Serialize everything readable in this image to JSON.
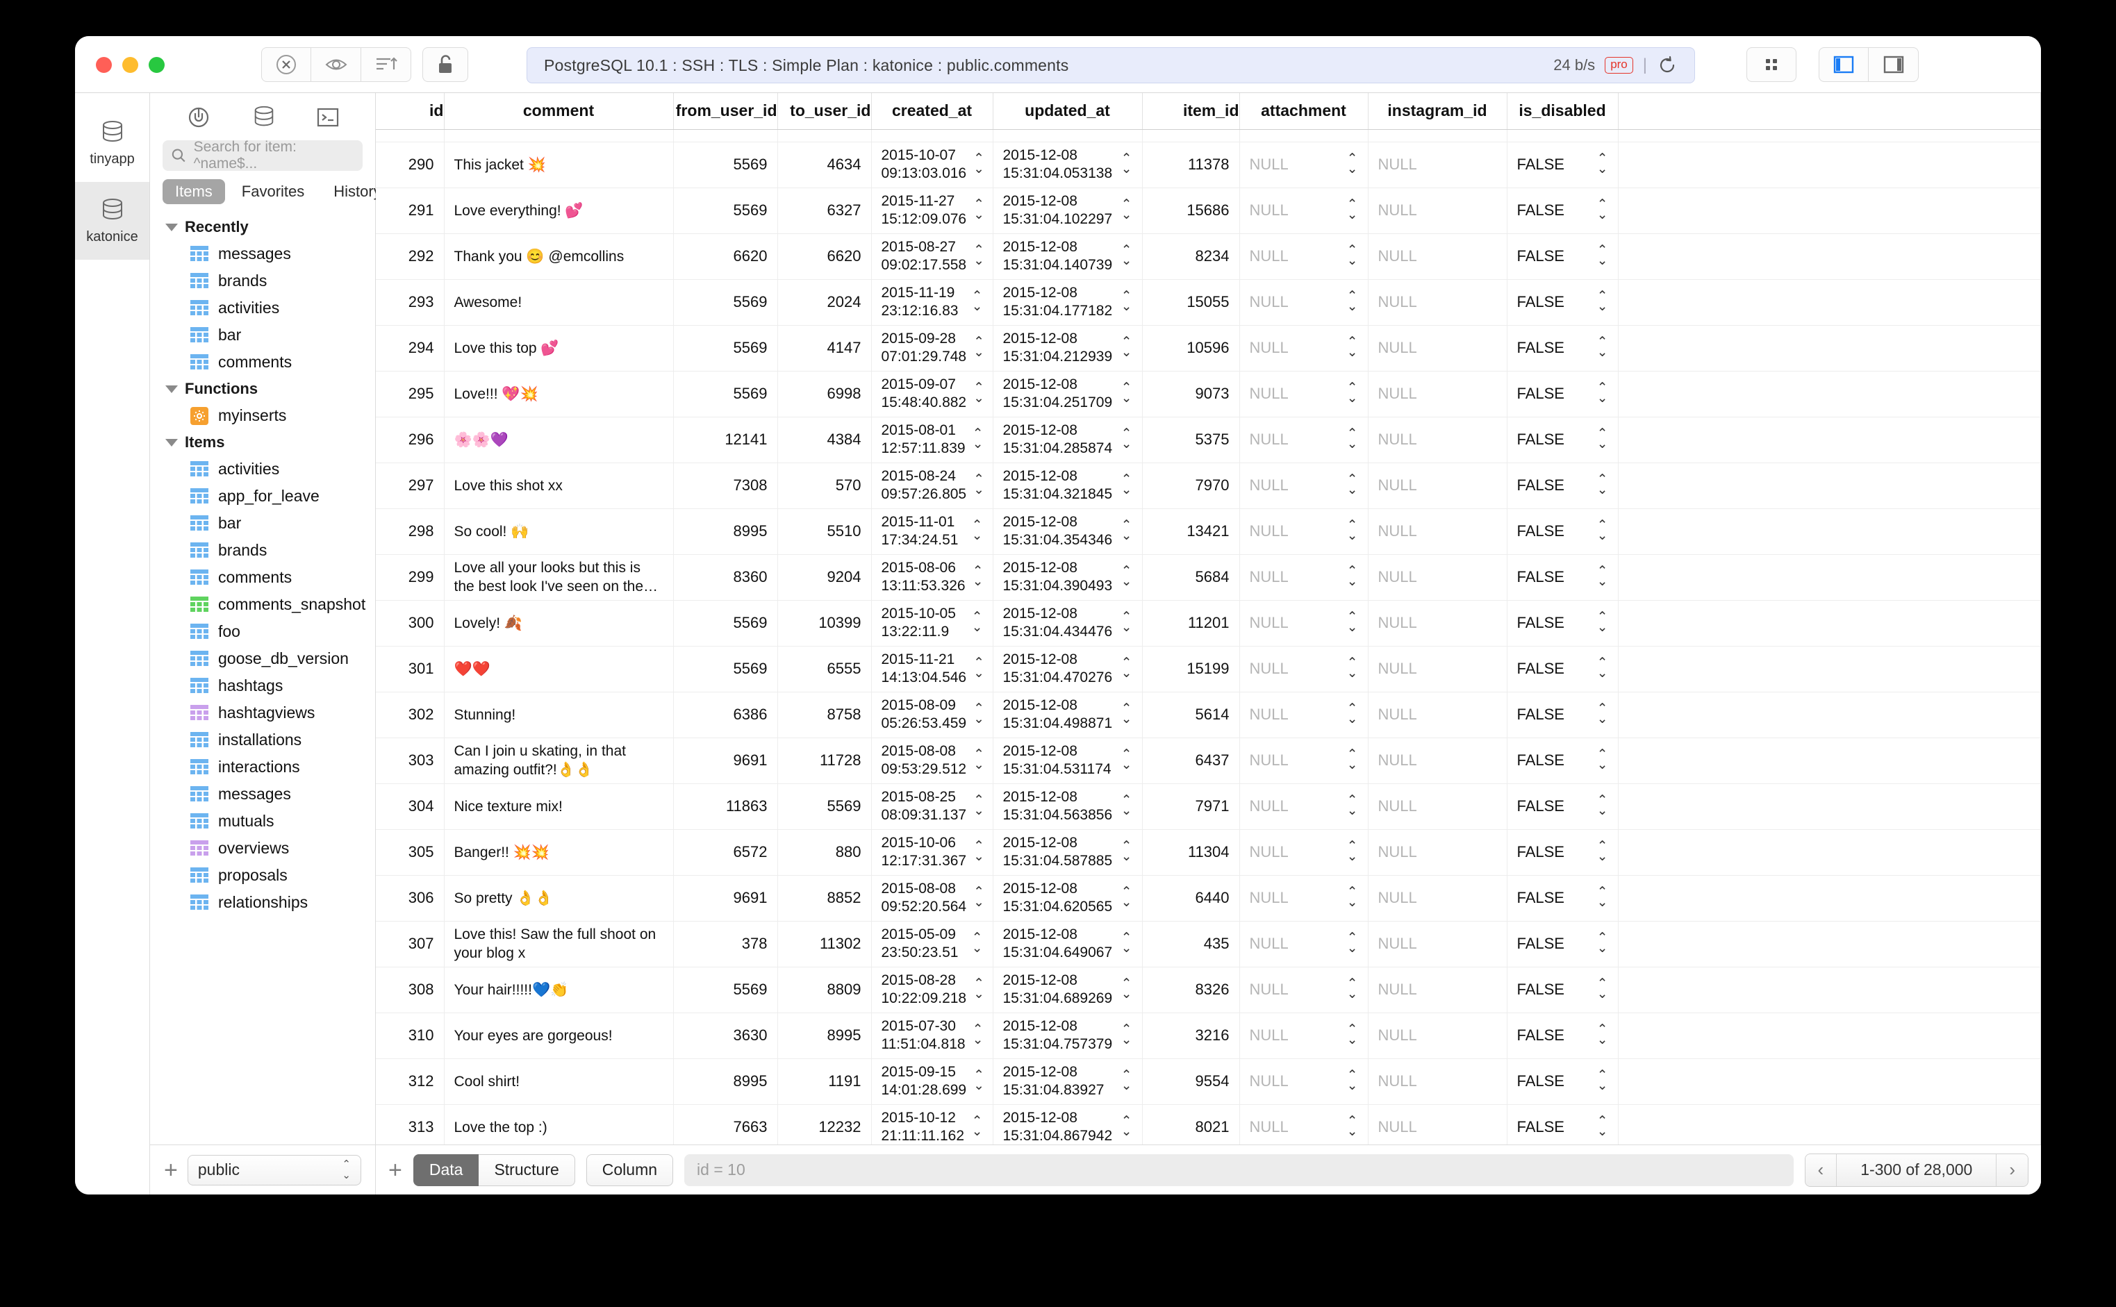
{
  "window": {
    "title": "PostgreSQL 10.1 : SSH : TLS : Simple Plan : katonice : public.comments",
    "throughput": "24 b/s",
    "pro_badge": "pro",
    "separator": "|"
  },
  "rail": {
    "items": [
      {
        "label": "tinyapp",
        "icon": "database-icon",
        "selected": false
      },
      {
        "label": "katonice",
        "icon": "database-icon",
        "selected": true
      }
    ]
  },
  "sidebar": {
    "icons": [
      "plugin-icon",
      "database-icon",
      "terminal-icon"
    ],
    "search": {
      "placeholder": "Search for item: ^name$..."
    },
    "tabs": [
      {
        "label": "Items",
        "selected": true
      },
      {
        "label": "Favorites",
        "selected": false
      },
      {
        "label": "History",
        "selected": false
      }
    ],
    "groups": [
      {
        "label": "Recently",
        "nodes": [
          {
            "label": "messages",
            "kind": "table",
            "color": "#6cb4f0"
          },
          {
            "label": "brands",
            "kind": "table",
            "color": "#6cb4f0"
          },
          {
            "label": "activities",
            "kind": "table",
            "color": "#6cb4f0"
          },
          {
            "label": "bar",
            "kind": "table",
            "color": "#6cb4f0"
          },
          {
            "label": "comments",
            "kind": "table",
            "color": "#6cb4f0"
          }
        ]
      },
      {
        "label": "Functions",
        "nodes": [
          {
            "label": "myinserts",
            "kind": "function",
            "color": "#f6a02f"
          }
        ]
      },
      {
        "label": "Items",
        "nodes": [
          {
            "label": "activities",
            "kind": "table",
            "color": "#6cb4f0"
          },
          {
            "label": "app_for_leave",
            "kind": "table",
            "color": "#6cb4f0"
          },
          {
            "label": "bar",
            "kind": "table",
            "color": "#6cb4f0"
          },
          {
            "label": "brands",
            "kind": "table",
            "color": "#6cb4f0"
          },
          {
            "label": "comments",
            "kind": "table",
            "color": "#6cb4f0"
          },
          {
            "label": "comments_snapshot",
            "kind": "table",
            "color": "#5fd35f"
          },
          {
            "label": "foo",
            "kind": "table",
            "color": "#6cb4f0"
          },
          {
            "label": "goose_db_version",
            "kind": "table",
            "color": "#6cb4f0"
          },
          {
            "label": "hashtags",
            "kind": "table",
            "color": "#6cb4f0"
          },
          {
            "label": "hashtagviews",
            "kind": "table",
            "color": "#c9a0ec"
          },
          {
            "label": "installations",
            "kind": "table",
            "color": "#6cb4f0"
          },
          {
            "label": "interactions",
            "kind": "table",
            "color": "#6cb4f0"
          },
          {
            "label": "messages",
            "kind": "table",
            "color": "#6cb4f0"
          },
          {
            "label": "mutuals",
            "kind": "table",
            "color": "#6cb4f0"
          },
          {
            "label": "overviews",
            "kind": "table",
            "color": "#c9a0ec"
          },
          {
            "label": "proposals",
            "kind": "table",
            "color": "#6cb4f0"
          },
          {
            "label": "relationships",
            "kind": "table",
            "color": "#6cb4f0"
          }
        ]
      }
    ],
    "footer": {
      "add_label": "+",
      "schema": "public"
    }
  },
  "grid": {
    "columns": [
      "id",
      "comment",
      "from_user_id",
      "to_user_id",
      "created_at",
      "updated_at",
      "item_id",
      "attachment",
      "instagram_id",
      "is_disabled"
    ],
    "rows": [
      {
        "id": "290",
        "comment": "This jacket 💥",
        "from_user_id": "5569",
        "to_user_id": "4634",
        "created_at": "2015-10-07\n09:13:03.016",
        "updated_at": "2015-12-08\n15:31:04.053138",
        "item_id": "11378",
        "attachment": "NULL",
        "instagram_id": "NULL",
        "is_disabled": "FALSE"
      },
      {
        "id": "291",
        "comment": "Love everything! 💕",
        "from_user_id": "5569",
        "to_user_id": "6327",
        "created_at": "2015-11-27\n15:12:09.076",
        "updated_at": "2015-12-08\n15:31:04.102297",
        "item_id": "15686",
        "attachment": "NULL",
        "instagram_id": "NULL",
        "is_disabled": "FALSE"
      },
      {
        "id": "292",
        "comment": "Thank you 😊 @emcollins",
        "from_user_id": "6620",
        "to_user_id": "6620",
        "created_at": "2015-08-27\n09:02:17.558",
        "updated_at": "2015-12-08\n15:31:04.140739",
        "item_id": "8234",
        "attachment": "NULL",
        "instagram_id": "NULL",
        "is_disabled": "FALSE"
      },
      {
        "id": "293",
        "comment": "Awesome!",
        "from_user_id": "5569",
        "to_user_id": "2024",
        "created_at": "2015-11-19\n23:12:16.83",
        "updated_at": "2015-12-08\n15:31:04.177182",
        "item_id": "15055",
        "attachment": "NULL",
        "instagram_id": "NULL",
        "is_disabled": "FALSE"
      },
      {
        "id": "294",
        "comment": "Love this top 💕",
        "from_user_id": "5569",
        "to_user_id": "4147",
        "created_at": "2015-09-28\n07:01:29.748",
        "updated_at": "2015-12-08\n15:31:04.212939",
        "item_id": "10596",
        "attachment": "NULL",
        "instagram_id": "NULL",
        "is_disabled": "FALSE"
      },
      {
        "id": "295",
        "comment": "Love!!! 💖💥",
        "from_user_id": "5569",
        "to_user_id": "6998",
        "created_at": "2015-09-07\n15:48:40.882",
        "updated_at": "2015-12-08\n15:31:04.251709",
        "item_id": "9073",
        "attachment": "NULL",
        "instagram_id": "NULL",
        "is_disabled": "FALSE"
      },
      {
        "id": "296",
        "comment": "🌸🌸💜",
        "from_user_id": "12141",
        "to_user_id": "4384",
        "created_at": "2015-08-01\n12:57:11.839",
        "updated_at": "2015-12-08\n15:31:04.285874",
        "item_id": "5375",
        "attachment": "NULL",
        "instagram_id": "NULL",
        "is_disabled": "FALSE"
      },
      {
        "id": "297",
        "comment": "Love this shot xx",
        "from_user_id": "7308",
        "to_user_id": "570",
        "created_at": "2015-08-24\n09:57:26.805",
        "updated_at": "2015-12-08\n15:31:04.321845",
        "item_id": "7970",
        "attachment": "NULL",
        "instagram_id": "NULL",
        "is_disabled": "FALSE"
      },
      {
        "id": "298",
        "comment": "So cool! 🙌",
        "from_user_id": "8995",
        "to_user_id": "5510",
        "created_at": "2015-11-01\n17:34:24.51",
        "updated_at": "2015-12-08\n15:31:04.354346",
        "item_id": "13421",
        "attachment": "NULL",
        "instagram_id": "NULL",
        "is_disabled": "FALSE"
      },
      {
        "id": "299",
        "comment": "Love all your looks but this is the best look I've seen on the…",
        "from_user_id": "8360",
        "to_user_id": "9204",
        "created_at": "2015-08-06\n13:11:53.326",
        "updated_at": "2015-12-08\n15:31:04.390493",
        "item_id": "5684",
        "attachment": "NULL",
        "instagram_id": "NULL",
        "is_disabled": "FALSE"
      },
      {
        "id": "300",
        "comment": "Lovely! 🍂",
        "from_user_id": "5569",
        "to_user_id": "10399",
        "created_at": "2015-10-05\n13:22:11.9",
        "updated_at": "2015-12-08\n15:31:04.434476",
        "item_id": "11201",
        "attachment": "NULL",
        "instagram_id": "NULL",
        "is_disabled": "FALSE"
      },
      {
        "id": "301",
        "comment": "❤️❤️",
        "from_user_id": "5569",
        "to_user_id": "6555",
        "created_at": "2015-11-21\n14:13:04.546",
        "updated_at": "2015-12-08\n15:31:04.470276",
        "item_id": "15199",
        "attachment": "NULL",
        "instagram_id": "NULL",
        "is_disabled": "FALSE"
      },
      {
        "id": "302",
        "comment": "Stunning!",
        "from_user_id": "6386",
        "to_user_id": "8758",
        "created_at": "2015-08-09\n05:26:53.459",
        "updated_at": "2015-12-08\n15:31:04.498871",
        "item_id": "5614",
        "attachment": "NULL",
        "instagram_id": "NULL",
        "is_disabled": "FALSE"
      },
      {
        "id": "303",
        "comment": "Can I join u skating, in that amazing outfit?!👌👌",
        "from_user_id": "9691",
        "to_user_id": "11728",
        "created_at": "2015-08-08\n09:53:29.512",
        "updated_at": "2015-12-08\n15:31:04.531174",
        "item_id": "6437",
        "attachment": "NULL",
        "instagram_id": "NULL",
        "is_disabled": "FALSE"
      },
      {
        "id": "304",
        "comment": "Nice texture mix!",
        "from_user_id": "11863",
        "to_user_id": "5569",
        "created_at": "2015-08-25\n08:09:31.137",
        "updated_at": "2015-12-08\n15:31:04.563856",
        "item_id": "7971",
        "attachment": "NULL",
        "instagram_id": "NULL",
        "is_disabled": "FALSE"
      },
      {
        "id": "305",
        "comment": "Banger!! 💥💥",
        "from_user_id": "6572",
        "to_user_id": "880",
        "created_at": "2015-10-06\n12:17:31.367",
        "updated_at": "2015-12-08\n15:31:04.587885",
        "item_id": "11304",
        "attachment": "NULL",
        "instagram_id": "NULL",
        "is_disabled": "FALSE"
      },
      {
        "id": "306",
        "comment": "So pretty 👌👌",
        "from_user_id": "9691",
        "to_user_id": "8852",
        "created_at": "2015-08-08\n09:52:20.564",
        "updated_at": "2015-12-08\n15:31:04.620565",
        "item_id": "6440",
        "attachment": "NULL",
        "instagram_id": "NULL",
        "is_disabled": "FALSE"
      },
      {
        "id": "307",
        "comment": " Love this! Saw the full shoot on your blog x",
        "from_user_id": "378",
        "to_user_id": "11302",
        "created_at": "2015-05-09\n23:50:23.51",
        "updated_at": "2015-12-08\n15:31:04.649067",
        "item_id": "435",
        "attachment": "NULL",
        "instagram_id": "NULL",
        "is_disabled": "FALSE"
      },
      {
        "id": "308",
        "comment": "Your hair!!!!!💙👏",
        "from_user_id": "5569",
        "to_user_id": "8809",
        "created_at": "2015-08-28\n10:22:09.218",
        "updated_at": "2015-12-08\n15:31:04.689269",
        "item_id": "8326",
        "attachment": "NULL",
        "instagram_id": "NULL",
        "is_disabled": "FALSE"
      },
      {
        "id": "310",
        "comment": "Your eyes are gorgeous!",
        "from_user_id": "3630",
        "to_user_id": "8995",
        "created_at": "2015-07-30\n11:51:04.818",
        "updated_at": "2015-12-08\n15:31:04.757379",
        "item_id": "3216",
        "attachment": "NULL",
        "instagram_id": "NULL",
        "is_disabled": "FALSE"
      },
      {
        "id": "312",
        "comment": "Cool shirt!",
        "from_user_id": "8995",
        "to_user_id": "1191",
        "created_at": "2015-09-15\n14:01:28.699",
        "updated_at": "2015-12-08\n15:31:04.83927",
        "item_id": "9554",
        "attachment": "NULL",
        "instagram_id": "NULL",
        "is_disabled": "FALSE"
      },
      {
        "id": "313",
        "comment": "Love the top :)",
        "from_user_id": "7663",
        "to_user_id": "12232",
        "created_at": "2015-10-12\n21:11:11.162",
        "updated_at": "2015-12-08\n15:31:04.867942",
        "item_id": "8021",
        "attachment": "NULL",
        "instagram_id": "NULL",
        "is_disabled": "FALSE"
      }
    ]
  },
  "footer": {
    "add_label": "+",
    "modes": [
      {
        "label": "Data",
        "selected": true
      },
      {
        "label": "Structure",
        "selected": false
      }
    ],
    "column_label": "Column",
    "filter": {
      "placeholder": "id = 10"
    },
    "pager": {
      "prev": "‹",
      "range": "1-300 of 28,000",
      "next": "›"
    }
  }
}
